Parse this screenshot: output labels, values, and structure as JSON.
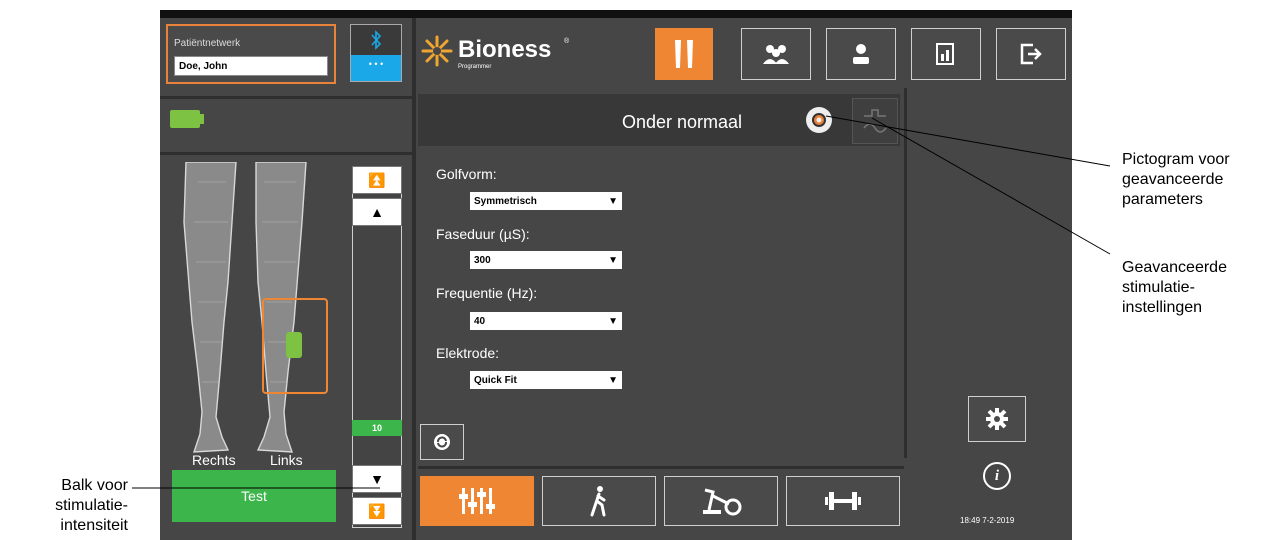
{
  "patient_network": {
    "label": "Patiëntnetwerk",
    "value": "Doe, John"
  },
  "bluetooth": {
    "dots": "• • •"
  },
  "brand": {
    "name": "Bioness",
    "sub": "Programmer",
    "reg": "®"
  },
  "top_nav": [
    {
      "icon": "legs-icon",
      "active": true
    },
    {
      "icon": "group-icon",
      "active": false
    },
    {
      "icon": "person-icon",
      "active": false
    },
    {
      "icon": "report-icon",
      "active": false
    },
    {
      "icon": "exit-icon",
      "active": false
    }
  ],
  "main": {
    "title": "Onder normaal",
    "fields": [
      {
        "label": "Golfvorm:",
        "value": "Symmetrisch"
      },
      {
        "label": "Faseduur (µS):",
        "value": "300"
      },
      {
        "label": "Frequentie (Hz):",
        "value": "40"
      },
      {
        "label": "Elektrode:",
        "value": "Quick Fit"
      }
    ]
  },
  "legs": {
    "right_label": "Rechts",
    "left_label": "Links"
  },
  "slider": {
    "value": "10",
    "value_fraction": 0.1
  },
  "test_button": "Test",
  "timestamp": "18:49 7-2-2019",
  "callouts": {
    "advanced_params": "Pictogram voor\ngeavanceerde\nparameters",
    "advanced_stim": "Geavanceerde\nstimulatie-\ninstellingen",
    "intensity_bar": "Balk voor\nstimulatie-\nintensiteit"
  },
  "colors": {
    "accent": "#ee8633",
    "green": "#3cb54a",
    "bluetooth": "#1aa8e8",
    "battery": "#7dc242"
  }
}
